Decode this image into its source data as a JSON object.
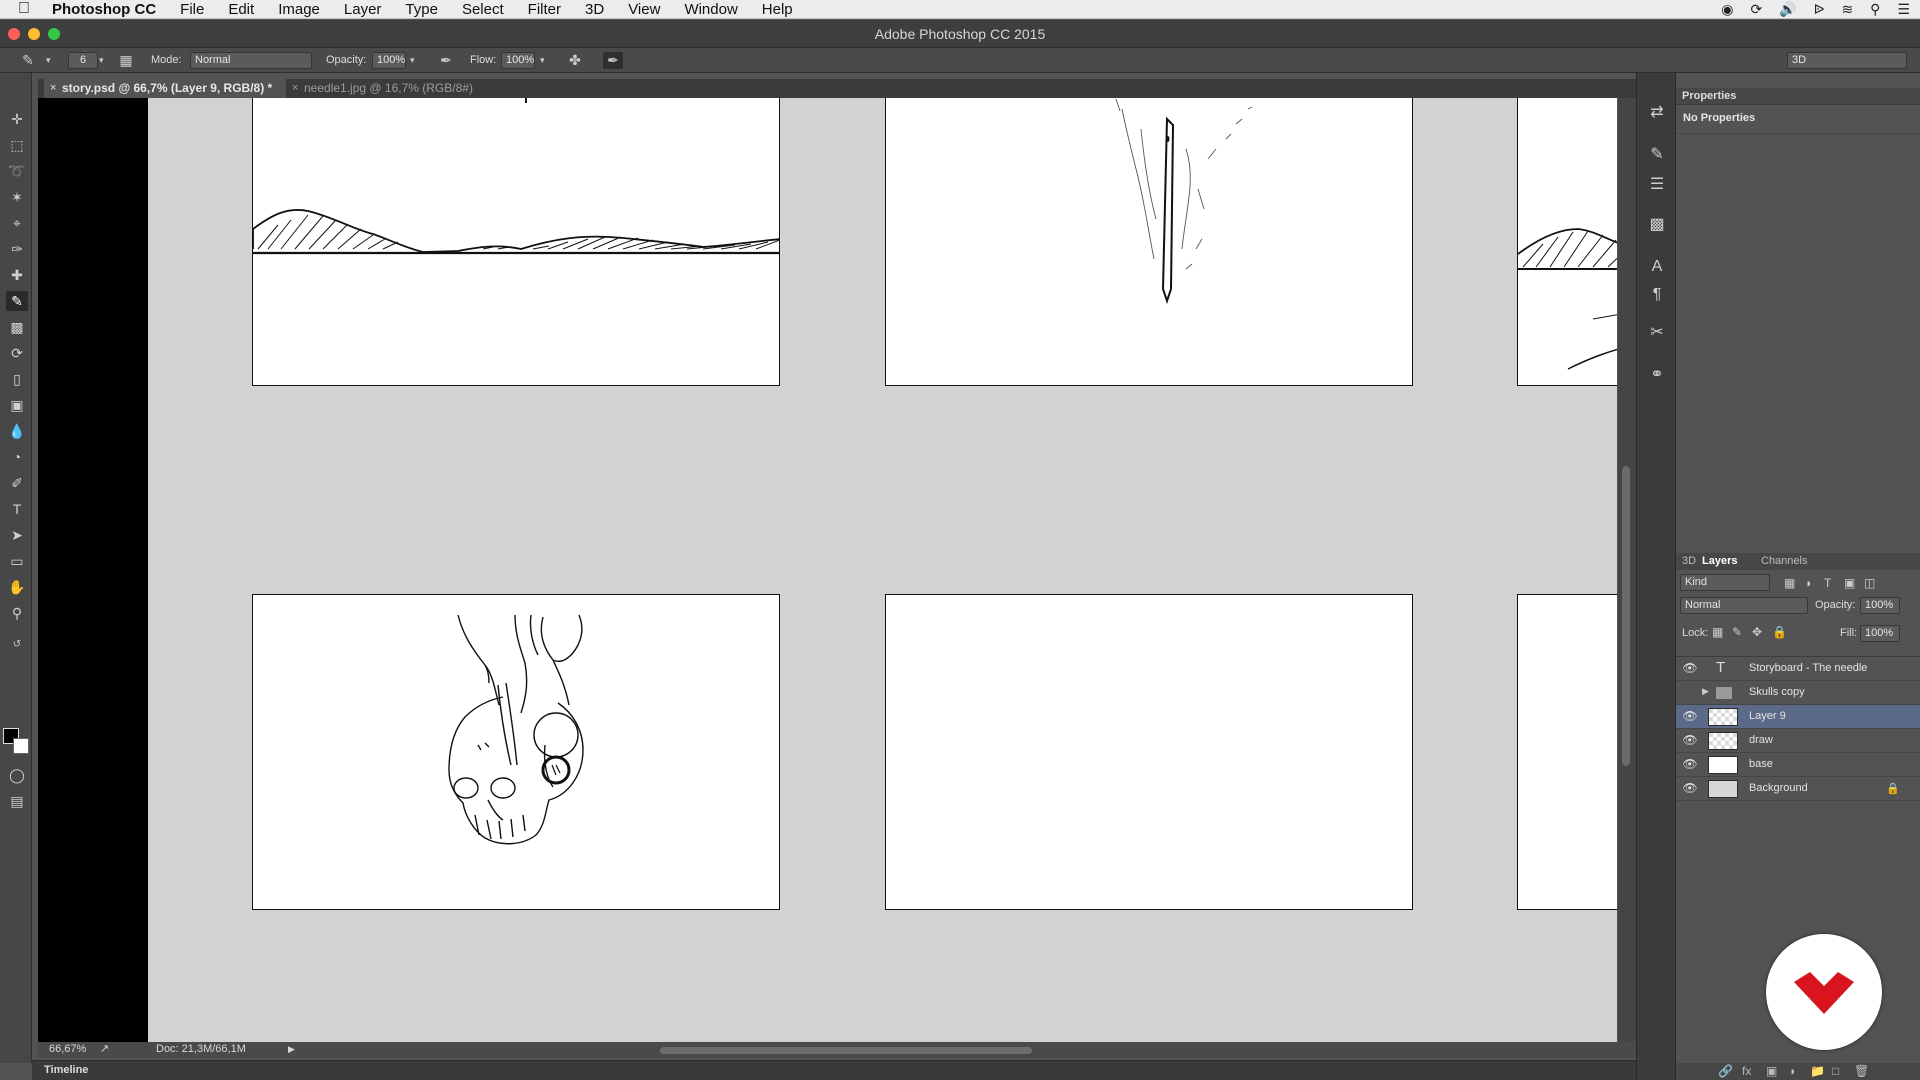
{
  "menubar": {
    "app_name": "Photoshop CC",
    "items": [
      "File",
      "Edit",
      "Image",
      "Layer",
      "Type",
      "Select",
      "Filter",
      "3D",
      "View",
      "Window",
      "Help"
    ]
  },
  "window": {
    "title": "Adobe Photoshop CC 2015"
  },
  "options": {
    "brush_size": "6",
    "mode_label": "Mode:",
    "mode_value": "Normal",
    "opacity_label": "Opacity:",
    "opacity_value": "100%",
    "flow_label": "Flow:",
    "flow_value": "100%",
    "workspace": "3D"
  },
  "tabs": [
    {
      "label": "story.psd @ 66,7% (Layer 9, RGB/8) *",
      "active": true
    },
    {
      "label": "needle1.jpg @ 16,7% (RGB/8#)",
      "active": false
    }
  ],
  "status": {
    "zoom": "66,67%",
    "doc": "Doc: 21,3M/66,1M"
  },
  "timeline": {
    "label": "Timeline"
  },
  "properties": {
    "title": "Properties",
    "empty_text": "No Properties"
  },
  "layers_panel": {
    "tabs": [
      "3D",
      "Layers",
      "Channels"
    ],
    "active_tab": "Layers",
    "filter_kind": "Kind",
    "blend_mode": "Normal",
    "opacity_label": "Opacity:",
    "opacity_value": "100%",
    "lock_label": "Lock:",
    "fill_label": "Fill:",
    "fill_value": "100%",
    "layers": [
      {
        "name": "Storyboard - The needle",
        "type": "text",
        "visible": true,
        "selected": false
      },
      {
        "name": "Skulls copy",
        "type": "group",
        "visible": false,
        "selected": false
      },
      {
        "name": "Layer 9",
        "type": "pixel",
        "visible": true,
        "selected": true
      },
      {
        "name": "draw",
        "type": "pixel",
        "visible": true,
        "selected": false
      },
      {
        "name": "base",
        "type": "pixel",
        "visible": true,
        "selected": false
      },
      {
        "name": "Background",
        "type": "background",
        "visible": true,
        "selected": false,
        "locked": true
      }
    ]
  },
  "colors": {
    "selected_layer": "#5b6a86",
    "canvas_bg": "#d2d2d2",
    "logo_red": "#d8141e"
  }
}
